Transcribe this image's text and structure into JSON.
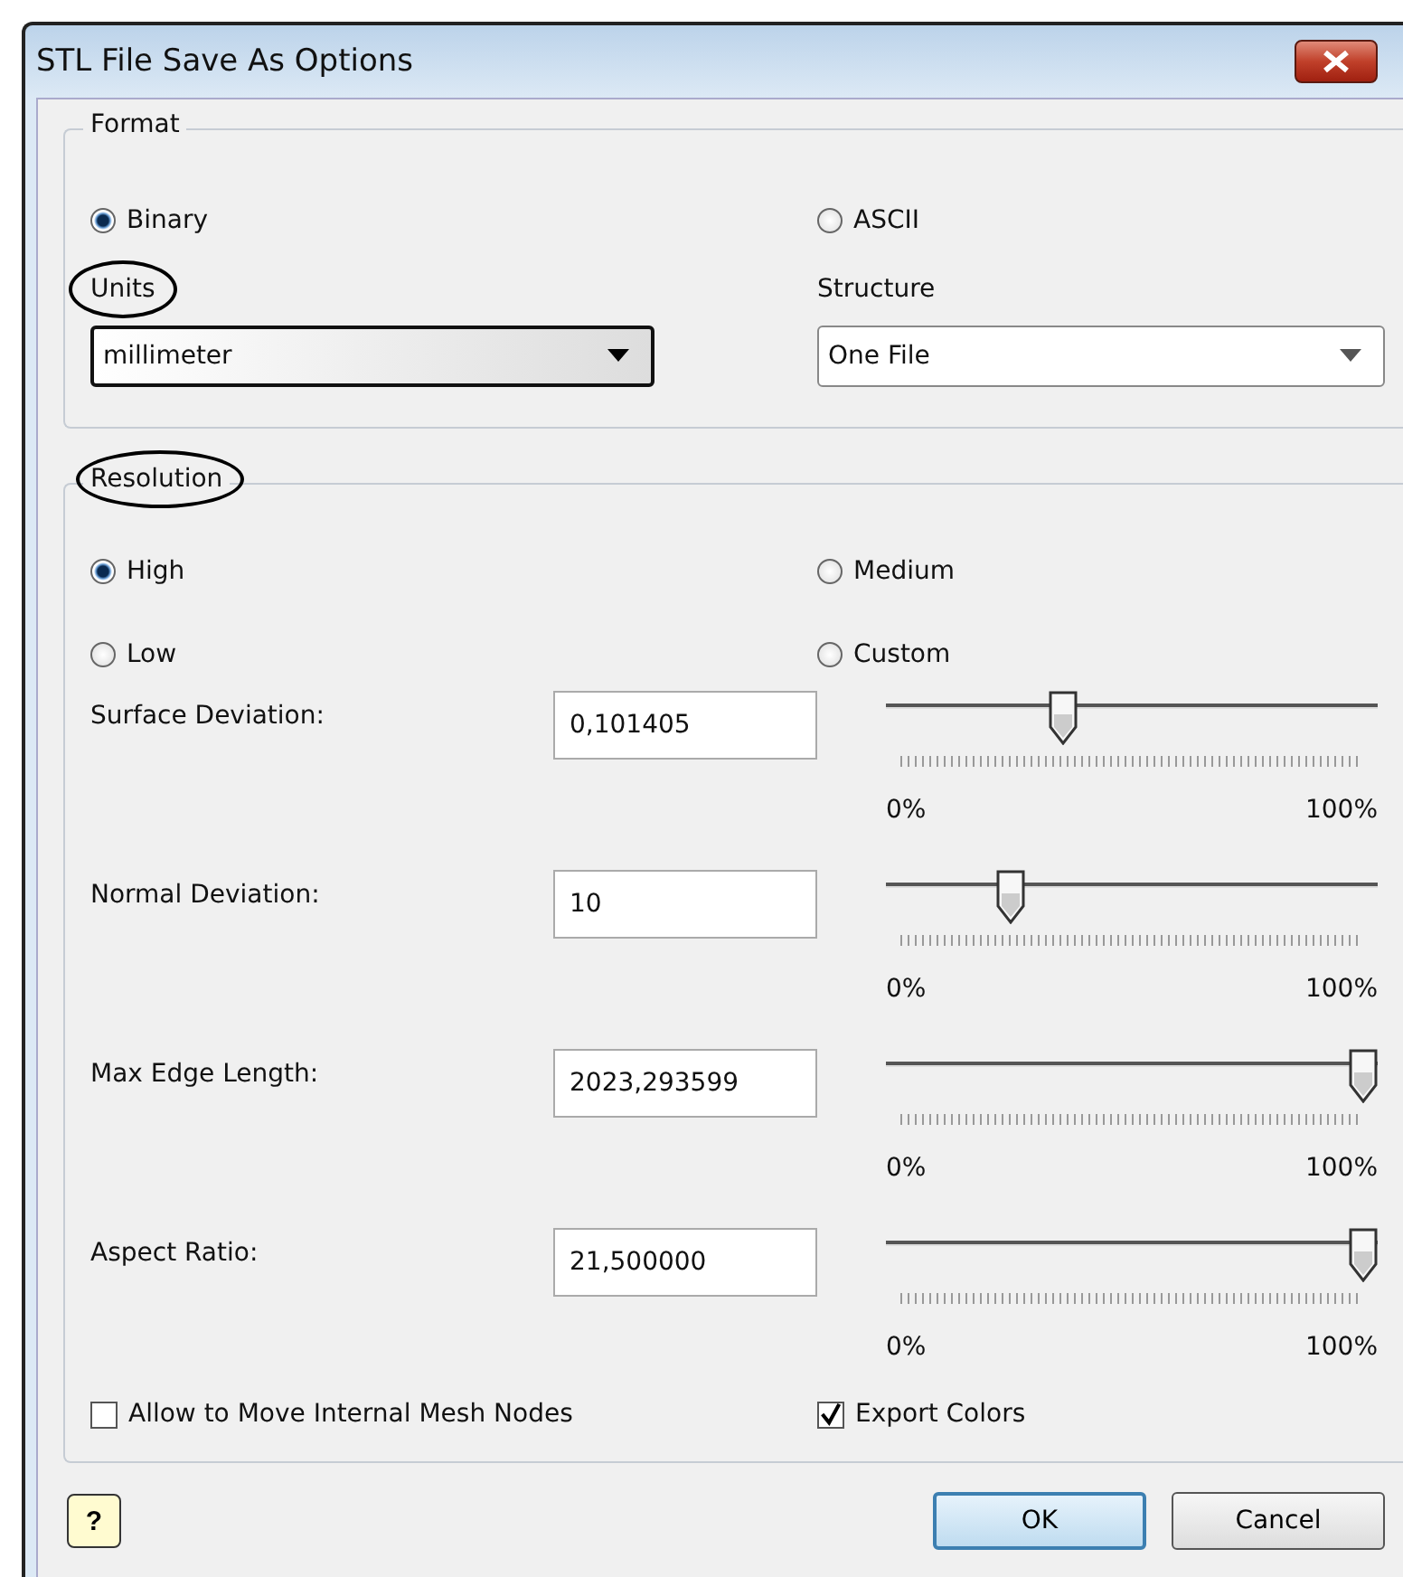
{
  "window": {
    "title": "STL File Save As Options"
  },
  "format": {
    "label": "Format",
    "options": [
      {
        "label": "Binary",
        "selected": true
      },
      {
        "label": "ASCII",
        "selected": false
      }
    ],
    "units": {
      "label": "Units",
      "value": "millimeter",
      "annotated": true
    },
    "structure": {
      "label": "Structure",
      "value": "One File"
    }
  },
  "resolution": {
    "label": "Resolution",
    "annotated": true,
    "options": [
      {
        "label": "High",
        "selected": true
      },
      {
        "label": "Medium",
        "selected": false
      },
      {
        "label": "Low",
        "selected": false
      },
      {
        "label": "Custom",
        "selected": false
      }
    ],
    "parameters": [
      {
        "label": "Surface Deviation:",
        "value": "0,101405",
        "level": 0.35,
        "min_label": "0%",
        "max_label": "100%"
      },
      {
        "label": "Normal Deviation:",
        "value": "10",
        "level": 0.24,
        "min_label": "0%",
        "max_label": "100%"
      },
      {
        "label": "Max Edge Length:",
        "value": "2023,293599",
        "level": 1,
        "min_label": "0%",
        "max_label": "100%"
      },
      {
        "label": "Aspect Ratio:",
        "value": "21,500000",
        "level": 1,
        "min_label": "0%",
        "max_label": "100%"
      }
    ],
    "checkboxes": [
      {
        "label": "Allow to Move Internal Mesh Nodes",
        "checked": false
      },
      {
        "label": "Export Colors",
        "checked": true
      }
    ]
  },
  "help": {
    "glyph": "?"
  },
  "buttons": [
    {
      "label": "OK",
      "default": true
    },
    {
      "label": "Cancel",
      "default": false
    }
  ]
}
